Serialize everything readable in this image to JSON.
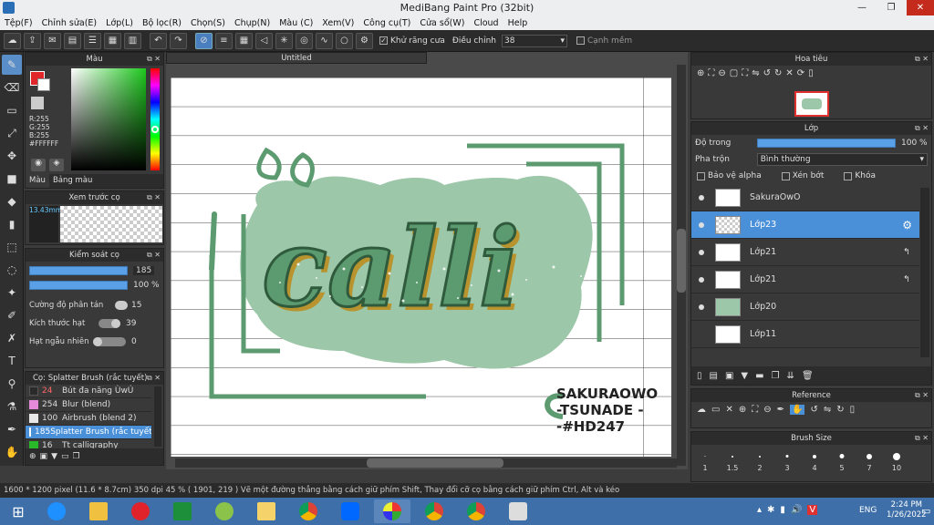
{
  "window": {
    "title": "MediBang Paint Pro (32bit)",
    "min": "—",
    "max": "❐",
    "close": "✕"
  },
  "menu": [
    "Tệp(F)",
    "Chỉnh sửa(E)",
    "Lớp(L)",
    "Bộ lọc(R)",
    "Chọn(S)",
    "Chụp(N)",
    "Màu (C)",
    "Xem(V)",
    "Công cụ(T)",
    "Cửa sổ(W)",
    "Cloud",
    "Help"
  ],
  "toolbar": {
    "antialias_label": "Khử răng cưa",
    "adjust_label": "Điều chỉnh",
    "adjust_value": "38",
    "smooth_label": "Cạnh mềm"
  },
  "color_panel": {
    "title": "Màu",
    "r": "R:255",
    "g": "G:255",
    "b": "B:255",
    "hex": "#FFFFFF",
    "tab1": "Màu",
    "tab2": "Bảng màu"
  },
  "preview_panel": {
    "title": "Xem trước cọ",
    "size": "13.43mm"
  },
  "brush_control": {
    "title": "Kiểm soát cọ",
    "size_value": "185",
    "opacity_value": "100 %",
    "scatter_label": "Cường độ phân tán",
    "scatter_value": "15",
    "grain_size_label": "Kích thước hạt",
    "grain_size_value": "39",
    "grain_random_label": "Hạt ngẫu nhiên",
    "grain_random_value": "0"
  },
  "brush_list": {
    "title": "Cọ: Splatter Brush (rắc tuyết)",
    "items": [
      {
        "size": "24",
        "name": "Bút đa năng ÙwÚ",
        "color": "#2a2a2a"
      },
      {
        "size": "254",
        "name": "Blur (blend)",
        "color": "#e58ad8"
      },
      {
        "size": "100",
        "name": "Airbrush (blend 2)",
        "color": "#e8e8e8"
      },
      {
        "size": "185",
        "name": "Splatter Brush (rắc tuyết)",
        "color": "#1f5fd6"
      },
      {
        "size": "16",
        "name": "Tt calligraphy",
        "color": "#28b828"
      }
    ]
  },
  "canvas": {
    "tab": "Untitled",
    "calli": "calli",
    "sig1": "SAKURAOWO",
    "sig2": "-TSUNADE -",
    "sig3": "-#HD247"
  },
  "navigator": {
    "title": "Hoa tiêu"
  },
  "layer_panel": {
    "title": "Lớp",
    "opacity_label": "Độ trong",
    "opacity_value": "100 %",
    "blend_label": "Pha trộn",
    "blend_value": "Bình thường",
    "protect_alpha": "Bảo vệ alpha",
    "clipping": "Xén bớt",
    "lock": "Khóa",
    "layers": [
      {
        "name": "SakuraOwO"
      },
      {
        "name": "Lớp23"
      },
      {
        "name": "Lớp21"
      },
      {
        "name": "Lớp21"
      },
      {
        "name": "Lớp20"
      },
      {
        "name": "Lớp11"
      }
    ]
  },
  "reference": {
    "title": "Reference"
  },
  "brush_size": {
    "title": "Brush Size",
    "sizes": [
      "1",
      "1.5",
      "2",
      "3",
      "4",
      "5",
      "7",
      "10"
    ]
  },
  "status": "1600 * 1200 pixel  (11.6 * 8.7cm)  350 dpi  45 %  ( 1901, 219 )  Vẽ một đường thẳng bằng cách giữ phím Shift, Thay đổi cỡ cọ bằng cách giữ phím Ctrl, Alt và kéo",
  "tray": {
    "lang": "ENG",
    "time": "2:24 PM",
    "date": "1/26/2022"
  },
  "colors": {
    "accent": "#4a90d9",
    "green": "#5c9a70",
    "light_green": "#9cc7a8"
  }
}
